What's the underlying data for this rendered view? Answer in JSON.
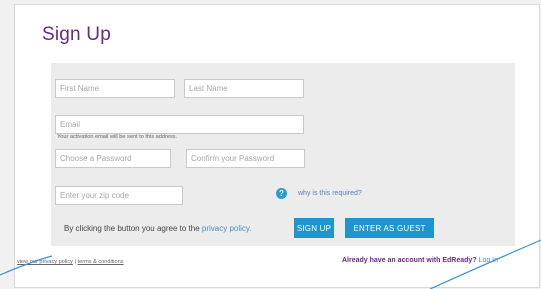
{
  "page": {
    "title": "Sign Up"
  },
  "form": {
    "first_name_placeholder": "First Name",
    "last_name_placeholder": "Last Name",
    "email_placeholder": "Email",
    "email_note": "Your activation email will be sent to this address.",
    "password_placeholder": "Choose a Password",
    "confirm_password_placeholder": "Confirm your Password",
    "zip_placeholder": "Enter your zip code",
    "help_icon": "?",
    "help_link": "why is this required?",
    "agree_prefix": "By clicking the button you agree to the",
    "agree_link": "privacy policy.",
    "signup_label": "SIGN UP",
    "guest_label": "ENTER AS GUEST"
  },
  "footer": {
    "privacy_link": "view our privacy policy",
    "separator": "|",
    "terms_link": "terms & conditions",
    "account_prompt": "Already have an account with EdReady?",
    "login_link": "Log In"
  },
  "colors": {
    "brand_purple": "#6b2a7e",
    "button_blue": "#1f95cf",
    "link_blue": "#4a90c8",
    "panel_gray": "#ececec"
  },
  "icons": {
    "help": "question-circle-icon"
  }
}
